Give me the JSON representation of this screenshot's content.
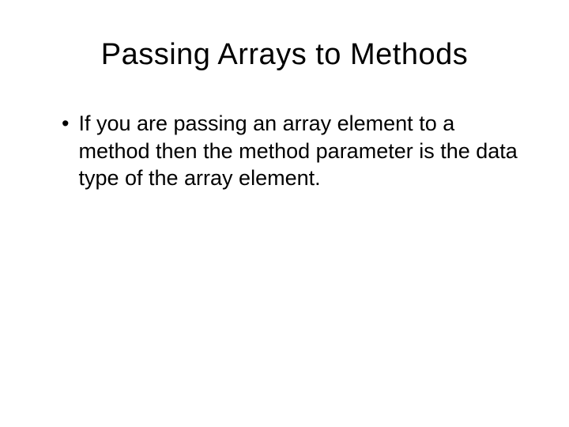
{
  "slide": {
    "title": "Passing Arrays to Methods",
    "bullets": [
      {
        "marker": "•",
        "text": "If you are passing an array element to a method then the method parameter is the data type of the array element."
      }
    ]
  }
}
